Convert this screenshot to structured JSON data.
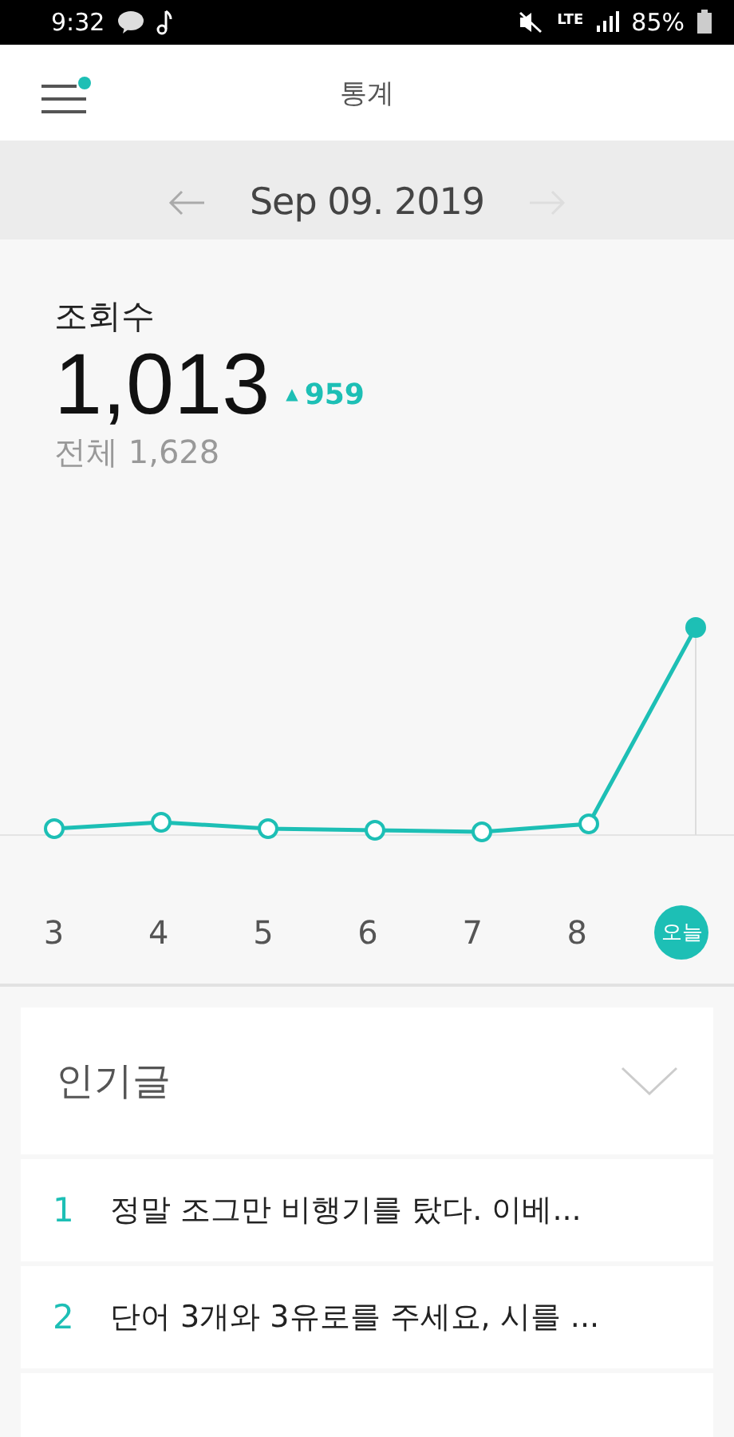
{
  "status_bar": {
    "time": "9:32",
    "network": "LTE",
    "battery": "85%"
  },
  "header": {
    "title": "통계",
    "menu_badge": true
  },
  "date_nav": {
    "date": "Sep 09. 2019",
    "prev_enabled": true,
    "next_enabled": false
  },
  "stats": {
    "label": "조회수",
    "value": "1,013",
    "change_icon": "▲",
    "change": "959",
    "total": "전체 1,628"
  },
  "chart": {
    "days": [
      {
        "label": "3",
        "selected": false
      },
      {
        "label": "4",
        "selected": false
      },
      {
        "label": "5",
        "selected": false
      },
      {
        "label": "6",
        "selected": false
      },
      {
        "label": "7",
        "selected": false
      },
      {
        "label": "8",
        "selected": false
      },
      {
        "label": "오늘",
        "selected": true
      }
    ]
  },
  "popular": {
    "title": "인기글",
    "expanded": false,
    "items": [
      {
        "rank": "1",
        "title": "정말 조그만 비행기를 탔다. 이베..."
      },
      {
        "rank": "2",
        "title": "단어 3개와 3유로를 주세요, 시를 ..."
      }
    ]
  }
}
